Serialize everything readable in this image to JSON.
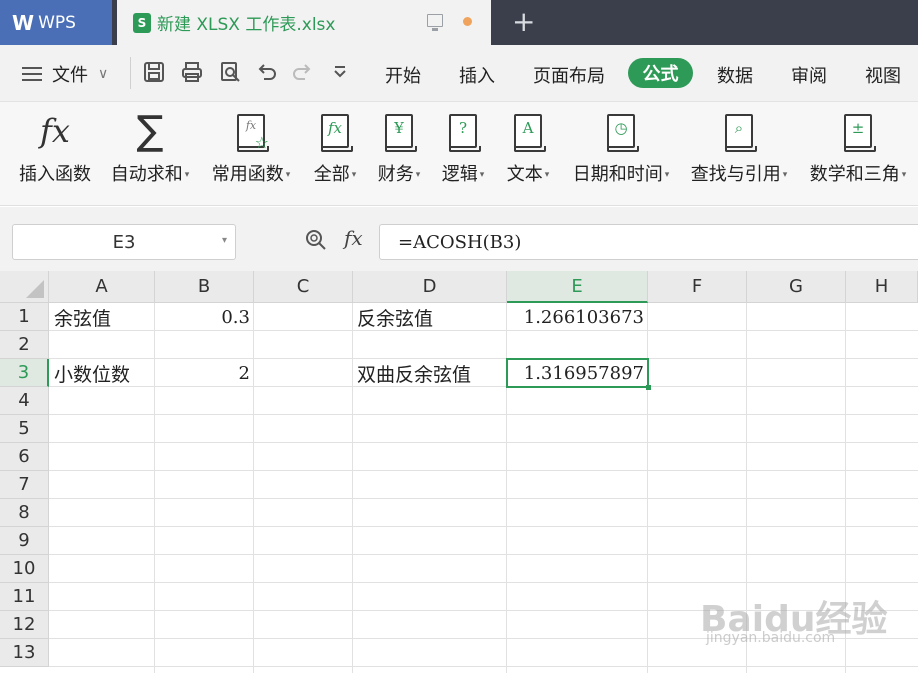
{
  "titlebar": {
    "app_name": "WPS",
    "doc_badge": "S",
    "doc_title": "新建 XLSX 工作表.xlsx",
    "new_tab": "+"
  },
  "menubar": {
    "file_label": "文件",
    "tabs": [
      "开始",
      "插入",
      "页面布局",
      "公式",
      "数据",
      "审阅",
      "视图"
    ],
    "active_tab": "公式"
  },
  "ribbon": {
    "buttons": [
      {
        "label": "插入函数",
        "icon": "fx-icon",
        "dropdown": false
      },
      {
        "label": "自动求和",
        "icon": "sigma-icon",
        "dropdown": true
      },
      {
        "label": "常用函数",
        "icon": "star-function-icon",
        "dropdown": true
      },
      {
        "label": "全部",
        "icon": "fx-book-icon",
        "dropdown": true
      },
      {
        "label": "财务",
        "icon": "yen-book-icon",
        "dropdown": true
      },
      {
        "label": "逻辑",
        "icon": "question-book-icon",
        "dropdown": true
      },
      {
        "label": "文本",
        "icon": "a-book-icon",
        "dropdown": true
      },
      {
        "label": "日期和时间",
        "icon": "clock-book-icon",
        "dropdown": true
      },
      {
        "label": "查找与引用",
        "icon": "search-book-icon",
        "dropdown": true
      },
      {
        "label": "数学和三角",
        "icon": "math-book-icon",
        "dropdown": true
      }
    ]
  },
  "formula_bar": {
    "cell_ref": "E3",
    "fx_label": "fx",
    "formula": "=ACOSH(B3)"
  },
  "sheet": {
    "columns": [
      "A",
      "B",
      "C",
      "D",
      "E",
      "F",
      "G",
      "H"
    ],
    "selected_column": "E",
    "rows": [
      "1",
      "2",
      "3",
      "4",
      "5",
      "6",
      "7",
      "8",
      "9",
      "10",
      "11",
      "12",
      "13"
    ],
    "selected_row": "3",
    "cells": {
      "A1": "余弦值",
      "B1": "0.3",
      "D1": "反余弦值",
      "E1": "1.266103673",
      "A3": "小数位数",
      "B3": "2",
      "D3": "双曲反余弦值",
      "E3": "1.316957897"
    }
  },
  "watermark": {
    "main": "Baidu经验",
    "sub": "jingyan.baidu.com"
  },
  "colors": {
    "accent": "#2e9a57",
    "wps_blue": "#4a6fb6",
    "titlebar": "#3a3f4b"
  }
}
